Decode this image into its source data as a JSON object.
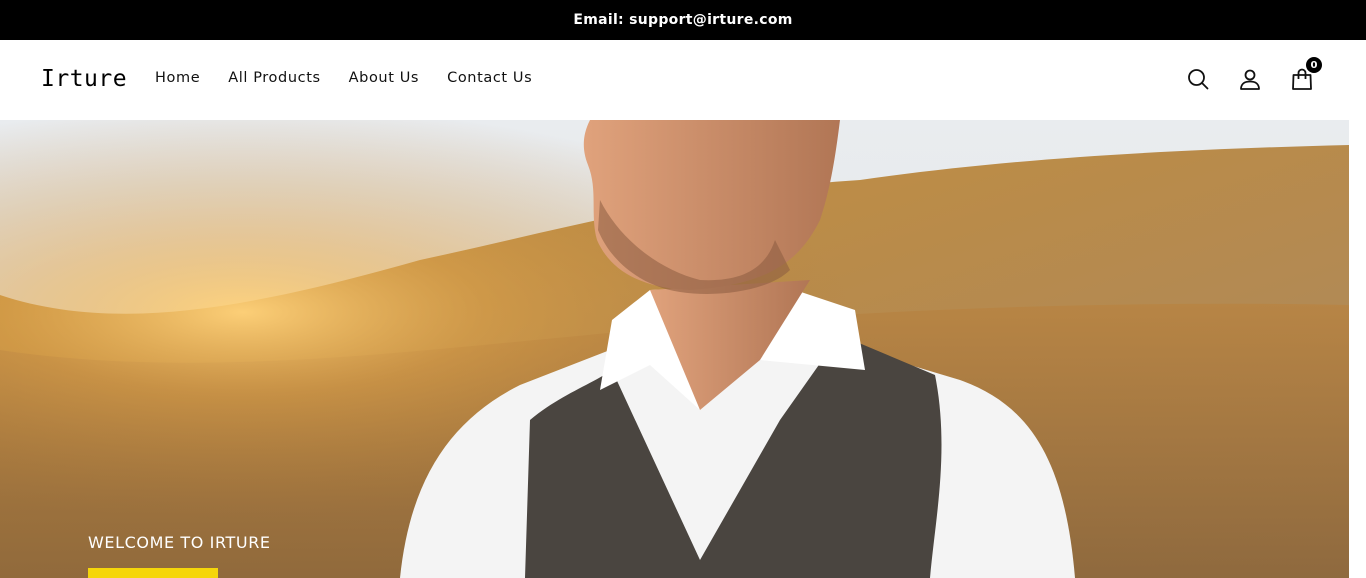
{
  "topbar": {
    "email_text": "Email: support@irture.com"
  },
  "header": {
    "logo": "Irture",
    "nav": [
      "Home",
      "All Products",
      "About Us",
      "Contact Us"
    ],
    "cart_count": "0"
  },
  "icons": {
    "search": "search-icon",
    "account": "user-icon",
    "cart": "shopping-bag-icon"
  },
  "hero": {
    "welcome_text": "WELCOME TO IRTURE"
  },
  "colors": {
    "topbar_bg": "#000000",
    "cta_yellow": "#f5d60a"
  }
}
